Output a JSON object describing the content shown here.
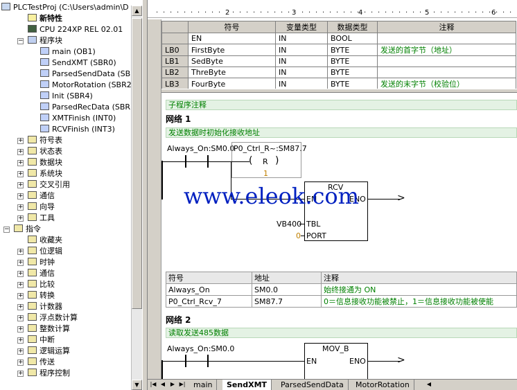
{
  "tree": {
    "project": "PLCTestProj (C:\\Users\\admin\\D",
    "items": [
      {
        "label": "新特性",
        "bold": true
      },
      {
        "label": "CPU 224XP REL 02.01"
      },
      {
        "label": "程序块"
      },
      {
        "label": "main (OB1)"
      },
      {
        "label": "SendXMT (SBR0)"
      },
      {
        "label": "ParsedSendData (SBR1"
      },
      {
        "label": "MotorRotation (SBR2)"
      },
      {
        "label": "Init (SBR4)"
      },
      {
        "label": "ParsedRecData (SBR5"
      },
      {
        "label": "XMTFinish (INT0)"
      },
      {
        "label": "RCVFinish (INT3)"
      },
      {
        "label": "符号表"
      },
      {
        "label": "状态表"
      },
      {
        "label": "数据块"
      },
      {
        "label": "系统块"
      },
      {
        "label": "交叉引用"
      },
      {
        "label": "通信"
      },
      {
        "label": "向导"
      },
      {
        "label": "工具"
      },
      {
        "label": "指令"
      },
      {
        "label": "收藏夹"
      },
      {
        "label": "位逻辑"
      },
      {
        "label": "时钟"
      },
      {
        "label": "通信"
      },
      {
        "label": "比较"
      },
      {
        "label": "转换"
      },
      {
        "label": "计数器"
      },
      {
        "label": "浮点数计算"
      },
      {
        "label": "整数计算"
      },
      {
        "label": "中断"
      },
      {
        "label": "逻辑运算"
      },
      {
        "label": "传送"
      },
      {
        "label": "程序控制"
      }
    ]
  },
  "ruler": {
    "marks": [
      "2",
      "3",
      "4",
      "5",
      "6"
    ]
  },
  "var_table": {
    "headers": [
      "符号",
      "变量类型",
      "数据类型",
      "注释"
    ],
    "rows": [
      {
        "addr": "",
        "sym": "EN",
        "vtype": "IN",
        "dtype": "BOOL",
        "comment": ""
      },
      {
        "addr": "LB0",
        "sym": "FirstByte",
        "vtype": "IN",
        "dtype": "BYTE",
        "comment": "发送的首字节（地址）"
      },
      {
        "addr": "LB1",
        "sym": "SedByte",
        "vtype": "IN",
        "dtype": "BYTE",
        "comment": ""
      },
      {
        "addr": "LB2",
        "sym": "ThreByte",
        "vtype": "IN",
        "dtype": "BYTE",
        "comment": ""
      },
      {
        "addr": "LB3",
        "sym": "FourByte",
        "vtype": "IN",
        "dtype": "BYTE",
        "comment": "发送的末字节（校验位）"
      }
    ]
  },
  "program": {
    "sub_comment": "子程序注释",
    "network1": {
      "title": "网络 1",
      "comment": "发送数据时初始化接收地址",
      "contact1": "Always_On:SM0.0",
      "coil_addr": "P0_Ctrl_R~:SM87.7",
      "coil_type": "R",
      "coil_n": "1",
      "block": "RCV",
      "en": "EN",
      "eno": "ENO",
      "tbl": "TBL",
      "port": "PORT",
      "tbl_val": "VB400",
      "port_val": "0"
    },
    "symtable": {
      "headers": [
        "符号",
        "地址",
        "注释"
      ],
      "rows": [
        {
          "sym": "Always_On",
          "addr": "SM0.0",
          "cmt": "始终接通为 ON"
        },
        {
          "sym": "P0_Ctrl_Rcv_7",
          "addr": "SM87.7",
          "cmt": "0＝信息接收功能被禁止，1＝信息接收功能被使能"
        }
      ]
    },
    "network2": {
      "title": "网络 2",
      "comment": "读取发送485数据",
      "contact1": "Always_On:SM0.0",
      "block": "MOV_B",
      "en": "EN",
      "eno": "ENO"
    }
  },
  "watermark": "www.eleok.com",
  "tabs": [
    "main",
    "SendXMT",
    "ParsedSendData",
    "MotorRotation"
  ]
}
